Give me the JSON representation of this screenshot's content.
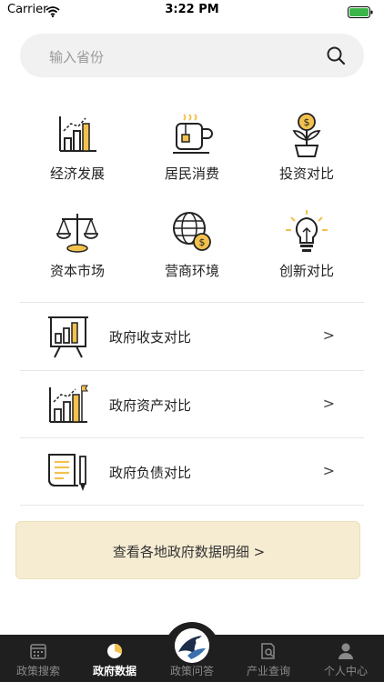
{
  "status": {
    "carrier": "Carrier",
    "time": "3:22 PM"
  },
  "search": {
    "placeholder": "输入省份"
  },
  "categories": [
    {
      "label": "经济发展",
      "icon": "bar-growth-icon"
    },
    {
      "label": "居民消费",
      "icon": "coffee-cup-icon"
    },
    {
      "label": "投资对比",
      "icon": "money-plant-icon"
    },
    {
      "label": "资本市场",
      "icon": "balance-scale-icon"
    },
    {
      "label": "营商环境",
      "icon": "globe-dollar-icon"
    },
    {
      "label": "创新对比",
      "icon": "light-bulb-icon"
    }
  ],
  "list": [
    {
      "label": "政府收支对比",
      "chevron": ">",
      "icon": "presentation-board-icon"
    },
    {
      "label": "政府资产对比",
      "chevron": ">",
      "icon": "bar-flag-icon"
    },
    {
      "label": "政府负债对比",
      "chevron": ">",
      "icon": "document-pencil-icon"
    }
  ],
  "banner": {
    "label": "查看各地政府数据明细 >"
  },
  "tabs": [
    {
      "label": "政策搜索",
      "icon": "calendar-icon",
      "active": false
    },
    {
      "label": "政府数据",
      "icon": "pie-chart-icon",
      "active": true
    },
    {
      "label": "政策问答",
      "icon": "logo-icon",
      "active": false
    },
    {
      "label": "产业查询",
      "icon": "doc-search-icon",
      "active": false
    },
    {
      "label": "个人中心",
      "icon": "user-icon",
      "active": false
    }
  ],
  "colors": {
    "accent": "#f2c14e",
    "banner": "#f6ecd2",
    "tabbar": "#1f1f1f"
  }
}
